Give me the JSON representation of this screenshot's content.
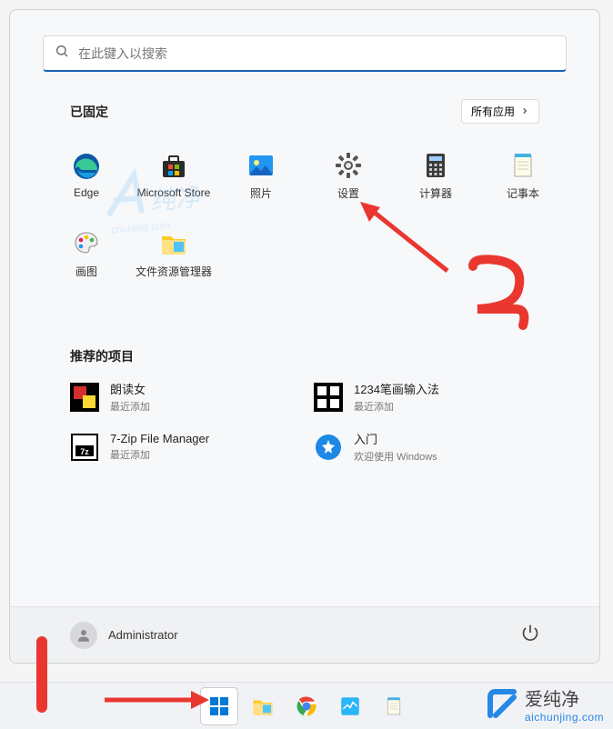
{
  "search": {
    "placeholder": "在此键入以搜索"
  },
  "pinned": {
    "title": "已固定",
    "all_apps_label": "所有应用",
    "apps": [
      {
        "name": "Edge"
      },
      {
        "name": "Microsoft Store"
      },
      {
        "name": "照片"
      },
      {
        "name": "设置"
      },
      {
        "name": "计算器"
      },
      {
        "name": "记事本"
      },
      {
        "name": "画图"
      },
      {
        "name": "文件资源管理器"
      }
    ]
  },
  "recommended": {
    "title": "推荐的项目",
    "items": [
      {
        "title": "朗读女",
        "subtitle": "最近添加"
      },
      {
        "title": "1234笔画输入法",
        "subtitle": "最近添加"
      },
      {
        "title": "7-Zip File Manager",
        "subtitle": "最近添加"
      },
      {
        "title": "入门",
        "subtitle": "欢迎使用 Windows"
      }
    ]
  },
  "user": {
    "name": "Administrator"
  },
  "watermark": {
    "top": "爱纯净",
    "brand_cn": "爱纯净",
    "brand_en": "aichunjing.com"
  },
  "annotations": {
    "one": "1",
    "two": "2"
  }
}
